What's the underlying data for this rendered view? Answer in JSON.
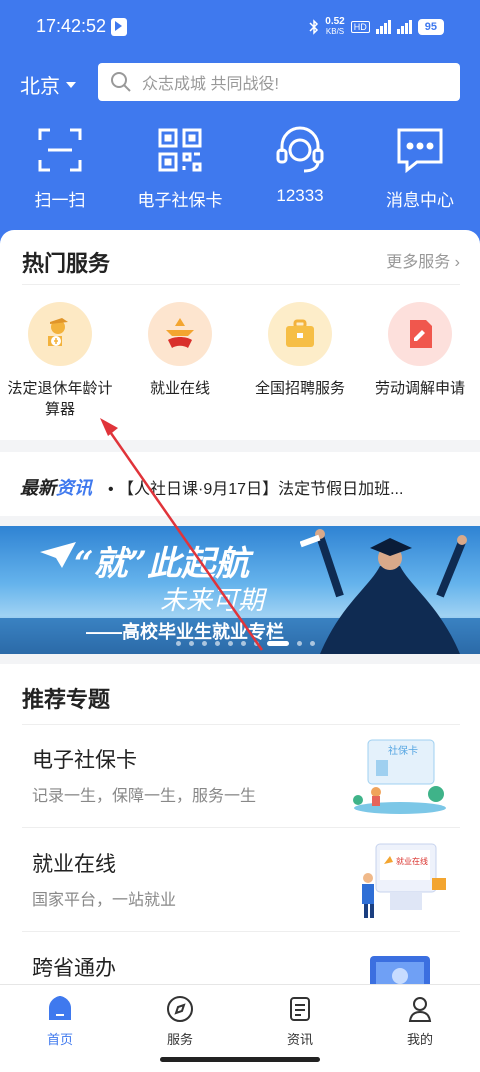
{
  "status": {
    "time": "17:42:52",
    "net_speed": "0.52",
    "net_unit": "KB/S",
    "hd": "HD",
    "battery": "95"
  },
  "header": {
    "city": "北京",
    "search_placeholder": "众志成城 共同战役!"
  },
  "quick": [
    {
      "label": "扫一扫",
      "icon": "scan-icon"
    },
    {
      "label": "电子社保卡",
      "icon": "qr-code-icon"
    },
    {
      "label": "12333",
      "icon": "headset-icon"
    },
    {
      "label": "消息中心",
      "icon": "message-icon"
    }
  ],
  "hot": {
    "title": "热门服务",
    "more": "更多服务",
    "items": [
      {
        "label": "法定退休年龄计算器",
        "icon": "retire-calculator-icon",
        "bg": "#fde9c4"
      },
      {
        "label": "就业在线",
        "icon": "employment-online-icon",
        "bg": "#fde5cf"
      },
      {
        "label": "全国招聘服务",
        "icon": "briefcase-icon",
        "bg": "#fdedc9"
      },
      {
        "label": "劳动调解申请",
        "icon": "document-edit-icon",
        "bg": "#fde0dc"
      }
    ]
  },
  "news": {
    "logo_a": "最新",
    "logo_b": "资讯",
    "text": "• 【人社日课·9月17日】法定节假日加班..."
  },
  "banner": {
    "title": "“就”此起航",
    "subtitle": "未来可期",
    "footer": "——高校毕业生就业专栏"
  },
  "recommend": {
    "title": "推荐专题",
    "items": [
      {
        "title": "电子社保卡",
        "sub": "记录一生，保障一生，服务一生",
        "art_text": "社保卡"
      },
      {
        "title": "就业在线",
        "sub": "国家平台，一站就业",
        "art_text": "就业在线"
      },
      {
        "title": "跨省通办",
        "sub": ""
      }
    ]
  },
  "tabs": [
    {
      "label": "首页",
      "active": true
    },
    {
      "label": "服务",
      "active": false
    },
    {
      "label": "资讯",
      "active": false
    },
    {
      "label": "我的",
      "active": false
    }
  ],
  "colors": {
    "primary": "#3f79ee",
    "annotation_arrow": "#e0343a"
  }
}
